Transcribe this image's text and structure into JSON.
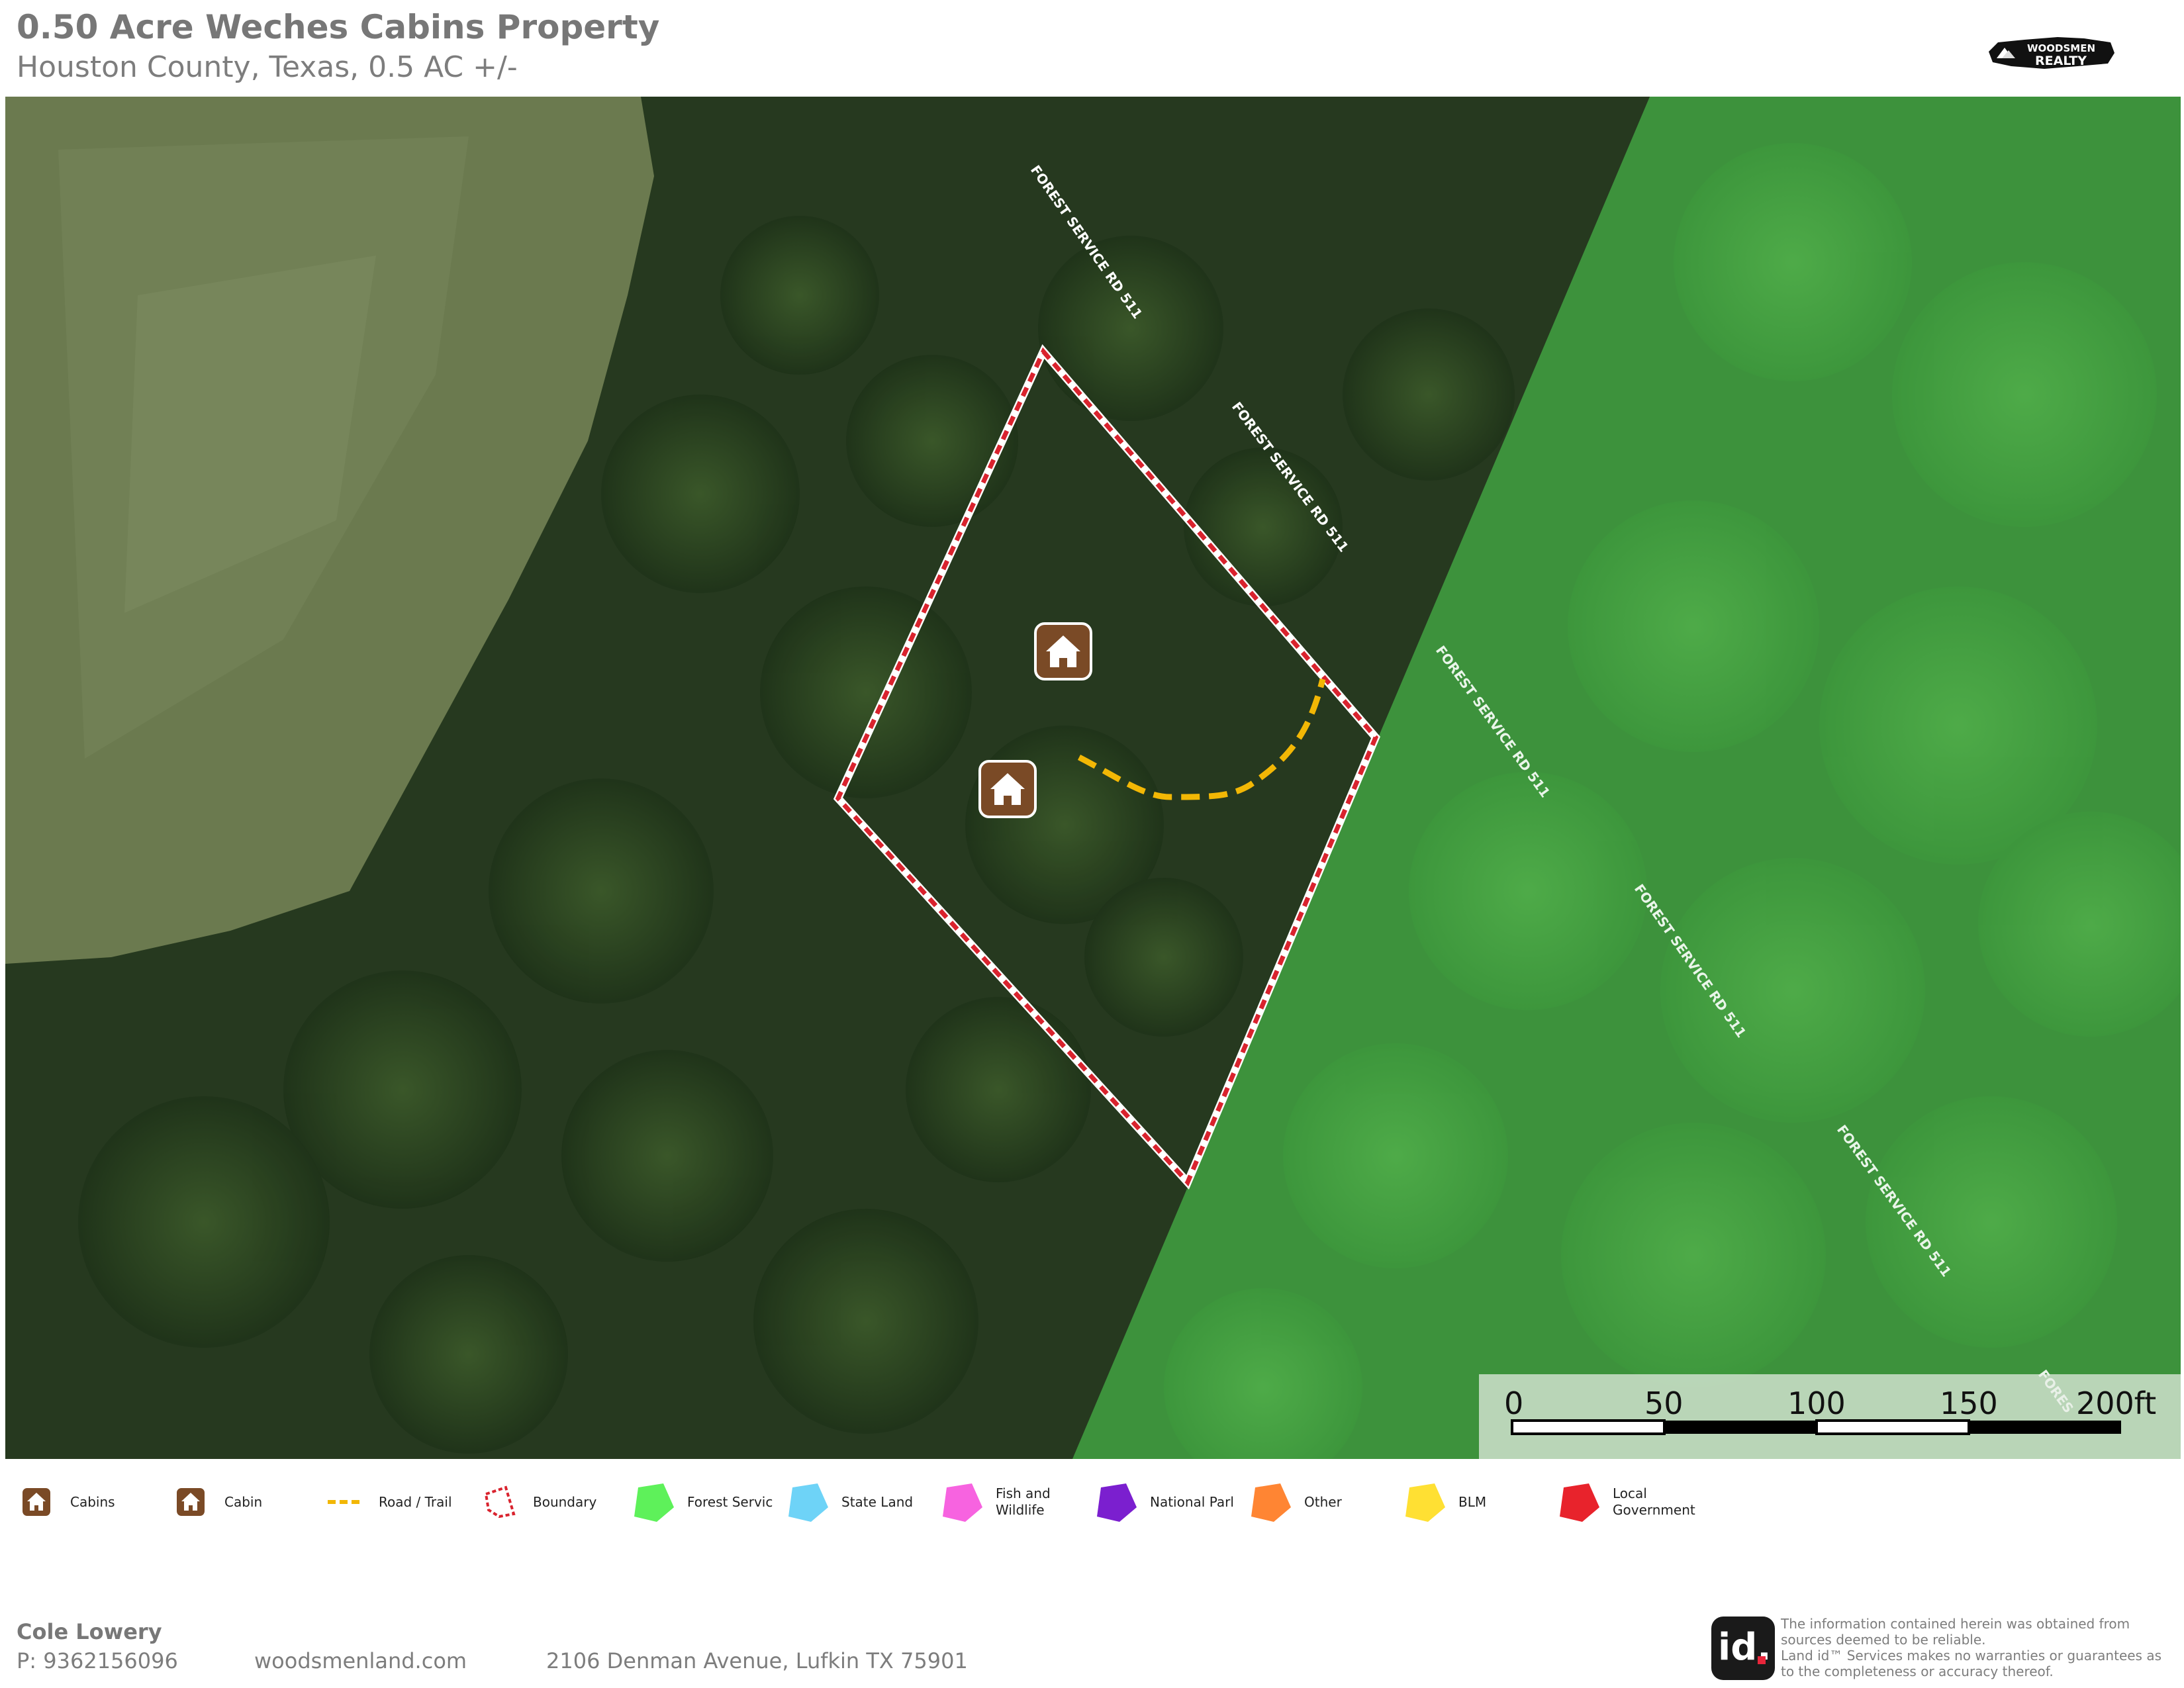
{
  "header": {
    "title": "0.50 Acre Weches Cabins Property",
    "subtitle": "Houston County, Texas, 0.5 AC +/-",
    "logo_text": "WOODSMEN REALTY"
  },
  "map": {
    "road_labels": [
      "FOREST SERVICE RD 511",
      "FOREST SERVICE RD 511",
      "FOREST SERVICE RD 511",
      "FOREST SERVICE RD 511",
      "FOREST SERVICE RD 511",
      "FORES"
    ],
    "markers": [
      "cabin",
      "cabin"
    ],
    "scale_bar": {
      "ticks": [
        "0",
        "50",
        "100",
        "150",
        "200ft"
      ]
    },
    "colors": {
      "boundary": "#d9232e",
      "trail": "#f2b705",
      "forest_service_overlay": "#4caf50",
      "marker": "#7a4a26"
    }
  },
  "legend": [
    {
      "label": "Cabins",
      "icon": "cabin-icon"
    },
    {
      "label": "Cabin",
      "icon": "cabin-icon"
    },
    {
      "label": "Road / Trail",
      "icon": "dashed-line-icon",
      "color": "#f2b705"
    },
    {
      "label": "Boundary",
      "icon": "boundary-polygon-icon",
      "color": "#d9232e"
    },
    {
      "label": "Forest Servic",
      "icon": "polygon-icon",
      "color": "#5ef15a"
    },
    {
      "label": "State Land",
      "icon": "polygon-icon",
      "color": "#6ed3f7"
    },
    {
      "label": "Fish and\nWildlife",
      "icon": "polygon-icon",
      "color": "#f763e0"
    },
    {
      "label": "National Parl",
      "icon": "polygon-icon",
      "color": "#7b1fcf"
    },
    {
      "label": "Other",
      "icon": "polygon-icon",
      "color": "#ff8533"
    },
    {
      "label": "BLM",
      "icon": "polygon-icon",
      "color": "#ffe033"
    },
    {
      "label": "Local\nGovernment",
      "icon": "polygon-icon",
      "color": "#e8232c"
    }
  ],
  "footer": {
    "name": "Cole Lowery",
    "phone": "P: 9362156096",
    "website": "woodsmenland.com",
    "address": "2106 Denman Avenue, Lufkin TX 75901",
    "badge": "id.",
    "disclaimer": "The information contained herein was obtained from sources deemed to be reliable.\n  Land id™ Services makes no warranties or guarantees as to the completeness or accuracy thereof."
  }
}
